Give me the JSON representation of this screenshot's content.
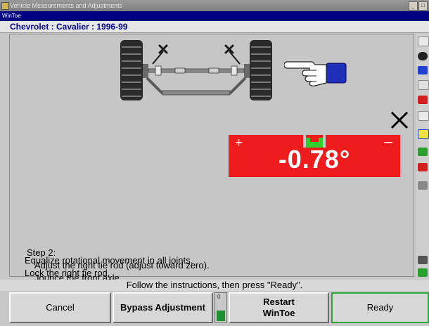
{
  "window": {
    "title": "Vehicle Measurements and Adjustments",
    "subtitle": "WinToe",
    "controls": [
      "_",
      "□"
    ]
  },
  "vehicle": "Chevrolet : Cavalier : 1996-99",
  "icons": {
    "axle": "front-axle-diagram-icon",
    "hand": "pointing-hand-icon",
    "close": "x-mark-icon",
    "target_lamp": "green-target-indicator-icon"
  },
  "gauge": {
    "plus": "+",
    "minus": "–",
    "reading": "-0.78°",
    "color": "#ee1c1c"
  },
  "instructions": {
    "title": "Step 2:",
    "lines": [
      "Adjust the right tie rod (adjust toward zero).",
      "Jounce the front axle.",
      "Equalize rotational movement in all joints.",
      "Lock the right tie rod."
    ]
  },
  "prompt": "Follow the instructions, then press \"Ready\".",
  "buttons": {
    "cancel": "Cancel",
    "bypass": "Bypass Adjustment",
    "restart": "Restart WinToe",
    "ready": "Ready"
  },
  "progress": {
    "level": 0.5,
    "scale_label": "0"
  },
  "colors": {
    "title_bar": "#000080",
    "vehicle_text": "#00008b",
    "ready_border": "#2fa93e",
    "progress_fill": "#1f8f2f"
  }
}
